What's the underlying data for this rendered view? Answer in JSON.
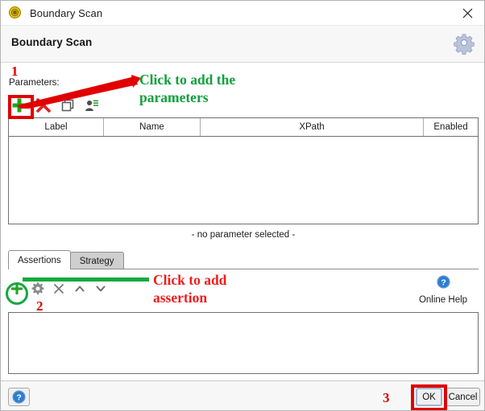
{
  "window": {
    "title": "Boundary Scan",
    "title_icon": "boundary-scan-badge-icon",
    "close_icon": "close-icon"
  },
  "header": {
    "title": "Boundary Scan",
    "settings_icon": "gear-icon"
  },
  "parameters": {
    "label": "Parameters:",
    "toolbar": [
      {
        "name": "add-parameter-button",
        "icon": "plus-icon",
        "color": "#1aa81a"
      },
      {
        "name": "delete-parameter-button",
        "icon": "x-icon",
        "color": "#e02020"
      },
      {
        "name": "copy-parameter-button",
        "icon": "copy-icon",
        "color": "#555555"
      },
      {
        "name": "import-parameter-button",
        "icon": "import-properties-icon",
        "color": "#555555"
      }
    ],
    "columns": [
      "Label",
      "Name",
      "XPath",
      "Enabled"
    ],
    "rows": [],
    "empty_selection_text": "- no parameter selected -"
  },
  "tabs": [
    {
      "label": "Assertions",
      "active": true
    },
    {
      "label": "Strategy",
      "active": false
    }
  ],
  "assertions": {
    "toolbar": [
      {
        "name": "add-assertion-button",
        "icon": "plus-icon",
        "color": "#2c9f2c"
      },
      {
        "name": "configure-assertion-button",
        "icon": "gear-icon",
        "color": "#8a8a8a"
      },
      {
        "name": "remove-assertion-button",
        "icon": "x-icon",
        "color": "#7a7a7a"
      },
      {
        "name": "move-assertion-up-button",
        "icon": "chevron-up-icon",
        "color": "#6e6e6e"
      },
      {
        "name": "move-assertion-down-button",
        "icon": "chevron-down-icon",
        "color": "#6e6e6e"
      }
    ],
    "rows": []
  },
  "online_help": {
    "label": "Online Help",
    "icon": "help-question-icon"
  },
  "footer": {
    "help_icon": "help-question-icon",
    "ok_label": "OK",
    "cancel_label": "Cancel"
  },
  "annotations": {
    "step1_number": "1",
    "step1_text_line1": "Click to add the",
    "step1_text_line2": "parameters",
    "step2_number": "2",
    "step2_text_line1": "Click to add",
    "step2_text_line2": "assertion",
    "step3_number": "3",
    "colors": {
      "red": "#e00000",
      "green": "#13a83f"
    }
  }
}
